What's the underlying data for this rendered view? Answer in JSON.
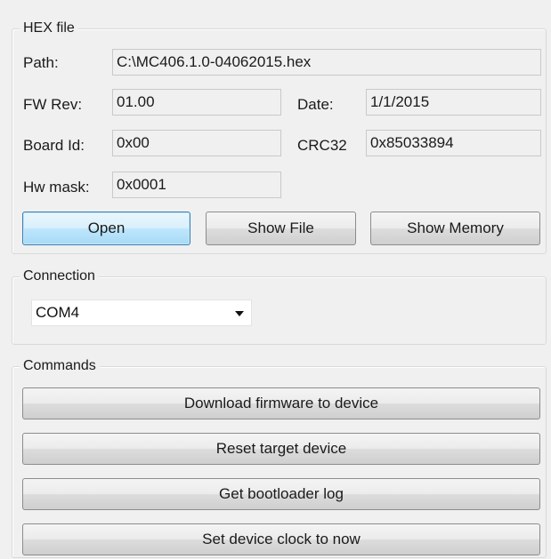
{
  "hex_file": {
    "group_title": "HEX file",
    "path_label": "Path:",
    "path_value": "C:\\MC406.1.0-04062015.hex",
    "fw_rev_label": "FW Rev:",
    "fw_rev_value": "01.00",
    "date_label": "Date:",
    "date_value": "1/1/2015",
    "board_id_label": "Board Id:",
    "board_id_value": "0x00",
    "crc32_label": "CRC32",
    "crc32_value": "0x85033894",
    "hw_mask_label": "Hw mask:",
    "hw_mask_value": "0x0001",
    "buttons": {
      "open": "Open",
      "show_file": "Show File",
      "show_memory": "Show Memory"
    }
  },
  "connection": {
    "group_title": "Connection",
    "port_value": "COM4",
    "dropdown_icon": "chevron-down-icon"
  },
  "commands": {
    "group_title": "Commands",
    "download": "Download firmware to device",
    "reset": "Reset target device",
    "get_log": "Get bootloader log",
    "set_clock": "Set device clock to now"
  },
  "colors": {
    "window_bg": "#f0f0f0",
    "focus_border": "#3c7fb1",
    "focus_fill": "#bee6fd"
  }
}
